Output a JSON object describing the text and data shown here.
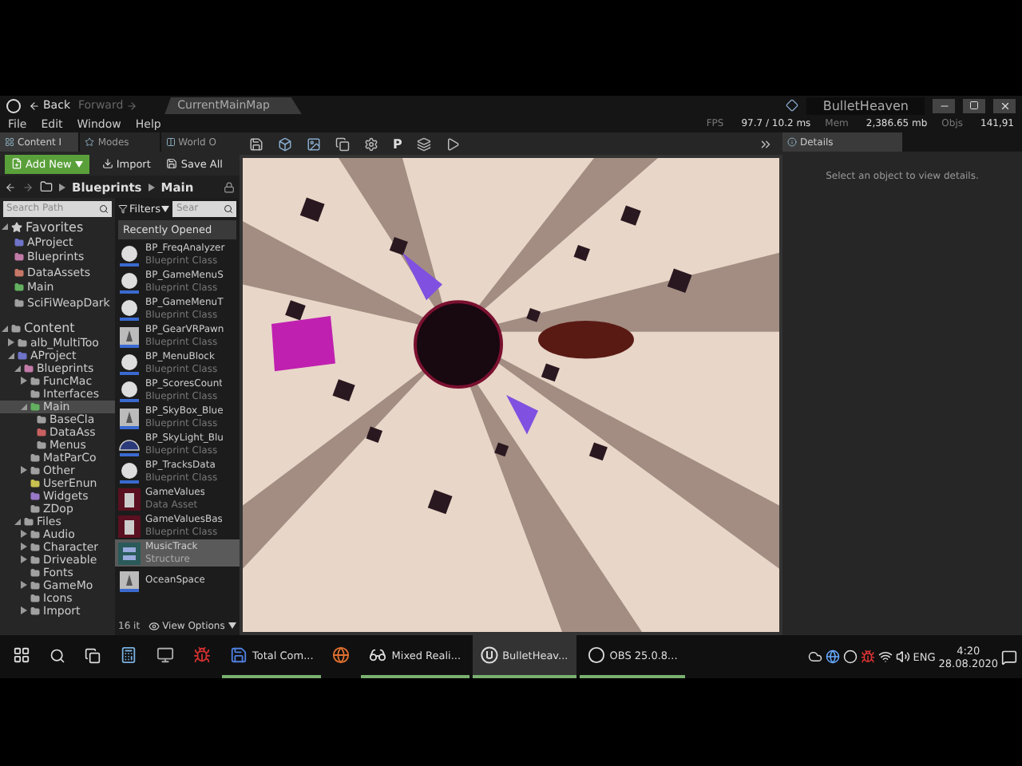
{
  "title_bar": {
    "nav": [
      {
        "label": "Back",
        "disabled": false
      },
      {
        "label": "Forward",
        "disabled": true
      }
    ],
    "document_tab": "CurrentMainMap",
    "project": "BulletHeaven"
  },
  "menu": [
    "File",
    "Edit",
    "Window",
    "Help"
  ],
  "stats": [
    {
      "label": "FPS",
      "value": "97.7 / 10.2 ms"
    },
    {
      "label": "Mem",
      "value": "2,386.65 mb"
    },
    {
      "label": "Objs",
      "value": "141,91"
    }
  ],
  "left_tabs": [
    {
      "label": "Content I",
      "selected": true
    },
    {
      "label": "Modes",
      "selected": false
    },
    {
      "label": "World O",
      "selected": false
    }
  ],
  "content_browser": {
    "buttons": [
      "Add New",
      "Import",
      "Save All"
    ],
    "path": [
      "Blueprints",
      "Main"
    ],
    "path_search": {
      "placeholder": "Search Path"
    },
    "filters": "Filters",
    "asset_search": {
      "placeholder": "Sear"
    },
    "favorites": {
      "label": "Favorites",
      "items": [
        {
          "label": "AProject",
          "color": "#6e74c8"
        },
        {
          "label": "Blueprints",
          "color": "#c27aa8"
        },
        {
          "label": "DataAssets",
          "color": "#c87868"
        },
        {
          "label": "Main",
          "color": "#62b060"
        },
        {
          "label": "SciFiWeapDark",
          "color": "#a0a0a0"
        }
      ]
    },
    "tree": [
      {
        "label": "Content",
        "color": "#a0a0a0",
        "selected": false,
        "collapsed": false,
        "children": [
          {
            "label": "alb_MultiToo",
            "color": "#a0a0a0",
            "selected": false,
            "collapsed": true
          },
          {
            "label": "AProject",
            "color": "#6e74c8",
            "selected": false,
            "collapsed": false,
            "children": [
              {
                "label": "Blueprints",
                "color": "#c27aa8",
                "selected": false,
                "collapsed": false,
                "children": [
                  {
                    "label": "FuncMac",
                    "color": "#a0a0a0",
                    "selected": false,
                    "collapsed": true
                  },
                  {
                    "label": "Interfaces",
                    "color": "#a0a0a0",
                    "selected": false,
                    "collapsed": false
                  },
                  {
                    "label": "Main",
                    "color": "#62b060",
                    "selected": true,
                    "collapsed": false,
                    "children": [
                      {
                        "label": "BaseCla",
                        "color": "#a0a0a0",
                        "selected": false,
                        "collapsed": false
                      },
                      {
                        "label": "DataAss",
                        "color": "#c86060",
                        "selected": false,
                        "collapsed": false
                      },
                      {
                        "label": "Menus",
                        "color": "#a0a0a0",
                        "selected": false,
                        "collapsed": false
                      }
                    ]
                  },
                  {
                    "label": "MatParCo",
                    "color": "#a0a0a0",
                    "selected": false,
                    "collapsed": false
                  },
                  {
                    "label": "Other",
                    "color": "#a0a0a0",
                    "selected": false,
                    "collapsed": true
                  },
                  {
                    "label": "UserEnun",
                    "color": "#c8c050",
                    "selected": false,
                    "collapsed": false
                  },
                  {
                    "label": "Widgets",
                    "color": "#9a78c8",
                    "selected": false,
                    "collapsed": false
                  },
                  {
                    "label": "ZDop",
                    "color": "#a0a0a0",
                    "selected": false,
                    "collapsed": false
                  }
                ]
              },
              {
                "label": "Files",
                "color": "#a0a0a0",
                "selected": false,
                "collapsed": false,
                "children": [
                  {
                    "label": "Audio",
                    "color": "#a0a0a0",
                    "selected": false,
                    "collapsed": true
                  },
                  {
                    "label": "Character",
                    "color": "#a0a0a0",
                    "selected": false,
                    "collapsed": true
                  },
                  {
                    "label": "Driveable",
                    "color": "#a0a0a0",
                    "selected": false,
                    "collapsed": true
                  },
                  {
                    "label": "Fonts",
                    "color": "#a0a0a0",
                    "selected": false,
                    "collapsed": false
                  },
                  {
                    "label": "GameMo",
                    "color": "#a0a0a0",
                    "selected": false,
                    "collapsed": true
                  },
                  {
                    "label": "Icons",
                    "color": "#a0a0a0",
                    "selected": false,
                    "collapsed": false
                  },
                  {
                    "label": "Import",
                    "color": "#a0a0a0",
                    "selected": false,
                    "collapsed": true
                  }
                ]
              }
            ]
          }
        ]
      }
    ],
    "assets": {
      "header": "Recently Opened",
      "items": [
        {
          "name": "BP_FreqAnalyzer",
          "type": "Blueprint Class",
          "kind": "sphere",
          "selected": false
        },
        {
          "name": "BP_GameMenuS",
          "type": "Blueprint Class",
          "kind": "sphere",
          "selected": false
        },
        {
          "name": "BP_GameMenuT",
          "type": "Blueprint Class",
          "kind": "sphere",
          "selected": false
        },
        {
          "name": "BP_GearVRPawn",
          "type": "Blueprint Class",
          "kind": "pawn",
          "selected": false
        },
        {
          "name": "BP_MenuBlock",
          "type": "Blueprint Class",
          "kind": "sphere",
          "selected": false
        },
        {
          "name": "BP_ScoresCount",
          "type": "Blueprint Class",
          "kind": "sphere",
          "selected": false
        },
        {
          "name": "BP_SkyBox_Blue",
          "type": "Blueprint Class",
          "kind": "pawn",
          "selected": false
        },
        {
          "name": "BP_SkyLight_Blu",
          "type": "Blueprint Class",
          "kind": "dome",
          "selected": false
        },
        {
          "name": "BP_TracksData",
          "type": "Blueprint Class",
          "kind": "sphere",
          "selected": false
        },
        {
          "name": "GameValues",
          "type": "Data Asset",
          "kind": "data",
          "selected": false
        },
        {
          "name": "GameValuesBas",
          "type": "Blueprint Class",
          "kind": "data",
          "selected": false
        },
        {
          "name": "MusicTrack",
          "type": "Structure",
          "kind": "struct",
          "selected": true
        },
        {
          "name": "OceanSpace",
          "kind": "pawn",
          "selected": false
        }
      ]
    },
    "item_count": "16 it",
    "view_options": "View Options"
  },
  "viewport_toolbar": {
    "text_button": "P"
  },
  "details": {
    "tab": "Details",
    "empty_message": "Select an object to view details."
  },
  "taskbar": {
    "apps": [
      {
        "kind": "calculator",
        "running": false,
        "selected": false
      },
      {
        "kind": "window",
        "running": false,
        "selected": false
      },
      {
        "kind": "bug",
        "running": false,
        "selected": false
      },
      {
        "kind": "floppy",
        "label": "Total Com...",
        "running": true,
        "selected": false
      },
      {
        "kind": "browser",
        "running": false,
        "selected": false
      },
      {
        "kind": "goggles",
        "label": "Mixed Reali...",
        "running": true,
        "selected": false
      },
      {
        "kind": "engine",
        "label": "BulletHeav...",
        "running": true,
        "selected": true
      },
      {
        "kind": "record",
        "label": "OBS 25.0.8...",
        "running": true,
        "selected": false
      }
    ],
    "lang": "ENG",
    "time": "4:20",
    "date": "28.08.2020"
  }
}
